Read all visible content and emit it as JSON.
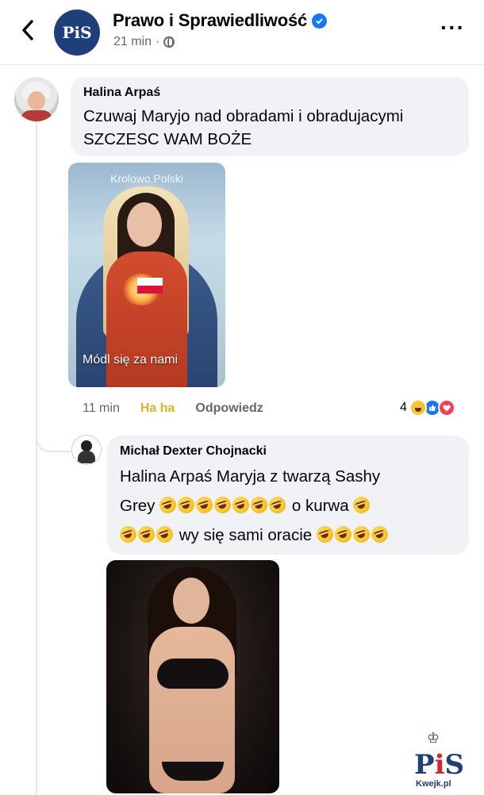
{
  "header": {
    "page_name": "Prawo i Sprawiedliwość",
    "avatar_text": "PiS",
    "time": "21 min",
    "separator": "·"
  },
  "comment1": {
    "author": "Halina Arpaś",
    "text_line1": "Czuwaj Maryjo nad obradami i obradujacymi",
    "text_line2": "SZCZESC WAM BOŻE",
    "image_title": "Krolowo Polski",
    "image_caption": "Módl się za nami",
    "time": "11 min",
    "reaction_label": "Ha ha",
    "reply_label": "Odpowiedz",
    "reaction_count": "4"
  },
  "comment2": {
    "author": "Michał Dexter Chojnacki",
    "line1": "Halina Arpaś Maryja z twarzą Sashy",
    "line2_word": "Grey",
    "line2_tail": "o kurwa",
    "line3_text": "wy się sami oracie"
  },
  "watermark": {
    "logo_text_p": "P",
    "logo_text_i": "i",
    "logo_text_s": "S",
    "site": "Kwejk.pl"
  },
  "colors": {
    "facebook_blue": "#1877f2",
    "bubble_gray": "#f0f2f5",
    "haha_yellow": "#e1b12c"
  }
}
